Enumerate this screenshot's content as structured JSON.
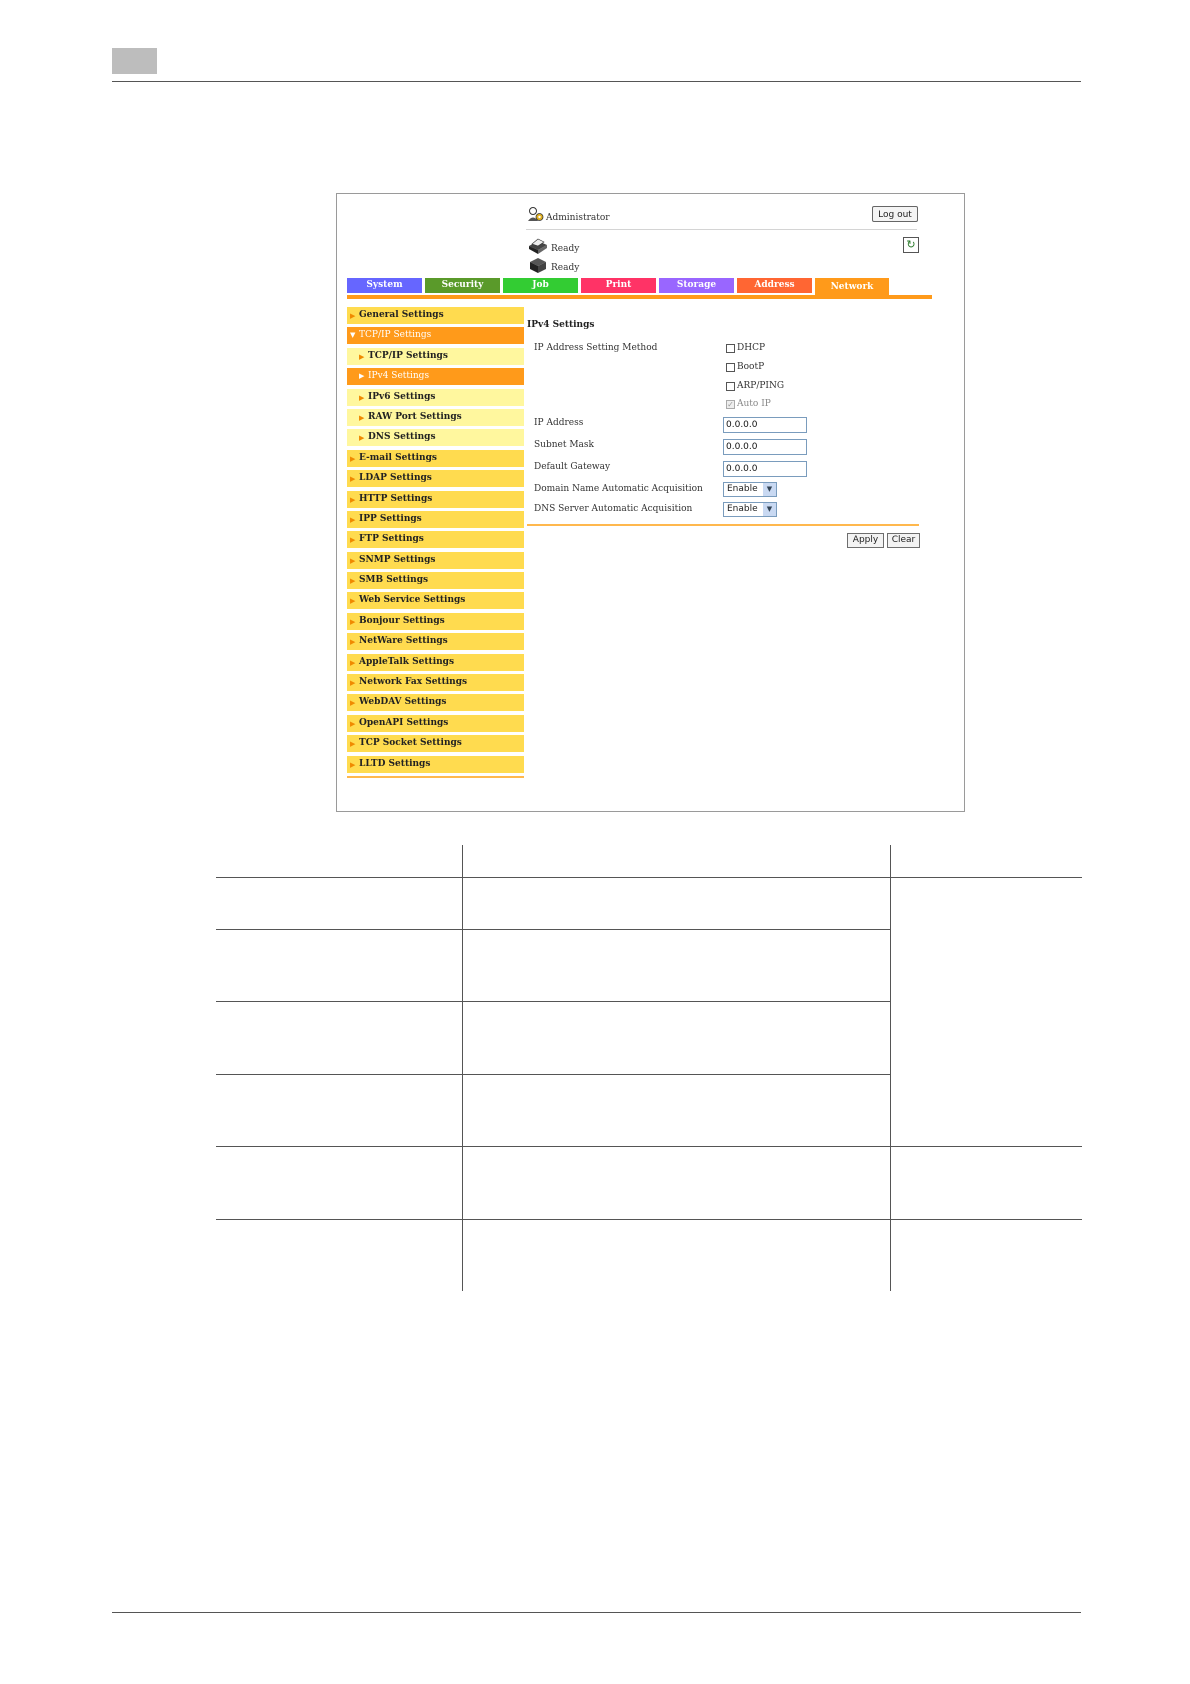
{
  "header": {
    "user_label": "Administrator",
    "logout_label": "Log out"
  },
  "status": [
    {
      "label": "Ready"
    },
    {
      "label": "Ready"
    }
  ],
  "tabs": [
    {
      "label": "System",
      "color": "#6666ff"
    },
    {
      "label": "Security",
      "color": "#5a9a2a"
    },
    {
      "label": "Job",
      "color": "#33cc33"
    },
    {
      "label": "Print",
      "color": "#ff3366"
    },
    {
      "label": "Storage",
      "color": "#9966ff"
    },
    {
      "label": "Address",
      "color": "#ff6633"
    },
    {
      "label": "Network",
      "color": "#ff9a1a"
    }
  ],
  "sidebar": {
    "items": [
      {
        "label": "General Settings"
      },
      {
        "label": "TCP/IP Settings"
      },
      {
        "label": "TCP/IP Settings"
      },
      {
        "label": "IPv4 Settings"
      },
      {
        "label": "IPv6 Settings"
      },
      {
        "label": "RAW Port Settings"
      },
      {
        "label": "DNS Settings"
      },
      {
        "label": "E-mail Settings"
      },
      {
        "label": "LDAP Settings"
      },
      {
        "label": "HTTP Settings"
      },
      {
        "label": "IPP Settings"
      },
      {
        "label": "FTP Settings"
      },
      {
        "label": "SNMP Settings"
      },
      {
        "label": "SMB Settings"
      },
      {
        "label": "Web Service Settings"
      },
      {
        "label": "Bonjour Settings"
      },
      {
        "label": "NetWare Settings"
      },
      {
        "label": "AppleTalk Settings"
      },
      {
        "label": "Network Fax Settings"
      },
      {
        "label": "WebDAV Settings"
      },
      {
        "label": "OpenAPI Settings"
      },
      {
        "label": "TCP Socket Settings"
      },
      {
        "label": "LLTD Settings"
      }
    ]
  },
  "main": {
    "title": "IPv4 Settings",
    "ip_method_label": "IP Address Setting Method",
    "methods": [
      {
        "label": "DHCP",
        "checked": false
      },
      {
        "label": "BootP",
        "checked": false
      },
      {
        "label": "ARP/PING",
        "checked": false
      },
      {
        "label": "Auto IP",
        "checked": true
      }
    ],
    "ip_address": {
      "label": "IP Address",
      "value": "0.0.0.0"
    },
    "subnet_mask": {
      "label": "Subnet Mask",
      "value": "0.0.0.0"
    },
    "default_gateway": {
      "label": "Default Gateway",
      "value": "0.0.0.0"
    },
    "domain_name_acq": {
      "label": "Domain Name Automatic Acquisition",
      "value": "Enable"
    },
    "dns_server_acq": {
      "label": "DNS Server Automatic Acquisition",
      "value": "Enable"
    },
    "apply_label": "Apply",
    "clear_label": "Clear"
  }
}
